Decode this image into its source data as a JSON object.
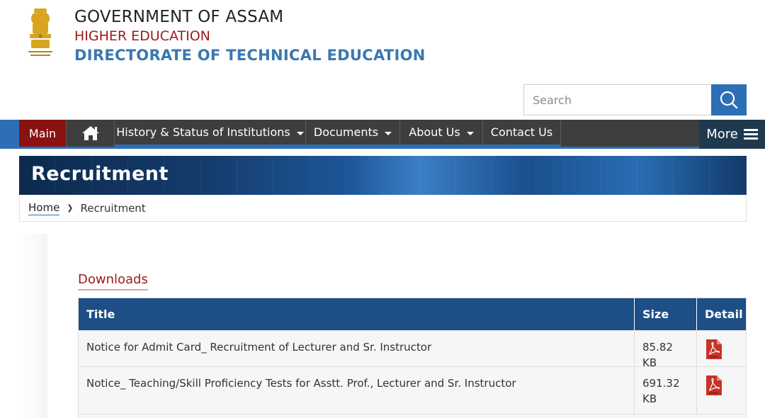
{
  "header": {
    "title": "GOVERNMENT OF ASSAM",
    "subtitle": "HIGHER EDUCATION",
    "department": "DIRECTORATE OF TECHNICAL EDUCATION",
    "emblem_icon": "national-emblem-icon"
  },
  "search": {
    "placeholder": "Search",
    "button_icon": "search-icon"
  },
  "nav": {
    "items": [
      {
        "label": "Main",
        "active": true
      },
      {
        "label": "",
        "icon": "home-icon"
      },
      {
        "label": "History & Status of Institutions",
        "dropdown": true
      },
      {
        "label": "Documents",
        "dropdown": true
      },
      {
        "label": "About Us",
        "dropdown": true
      },
      {
        "label": "Contact Us",
        "dropdown": false
      }
    ],
    "more_label": "More",
    "more_icon": "hamburger-icon"
  },
  "banner": {
    "title": "Recruitment"
  },
  "breadcrumb": {
    "home": "Home",
    "separator": "❯",
    "current": "Recruitment"
  },
  "downloads": {
    "heading": "Downloads",
    "columns": [
      "Title",
      "Size",
      "Detail"
    ],
    "rows": [
      {
        "title": "Notice for Admit Card_ Recruitment of Lecturer and Sr. Instructor",
        "size": "85.82 KB",
        "detail_icon": "pdf-icon"
      },
      {
        "title": "Notice_ Teaching/Skill Proficiency Tests for Asstt. Prof., Lecturer and Sr. Instructor",
        "size": "691.32 KB",
        "detail_icon": "pdf-icon"
      }
    ]
  },
  "colors": {
    "primary_blue": "#2c6fb5",
    "header_red": "#9b1b1b",
    "nav_dark": "#3e3e3e",
    "table_header": "#1d4f86",
    "main_tab": "#8b1212"
  }
}
